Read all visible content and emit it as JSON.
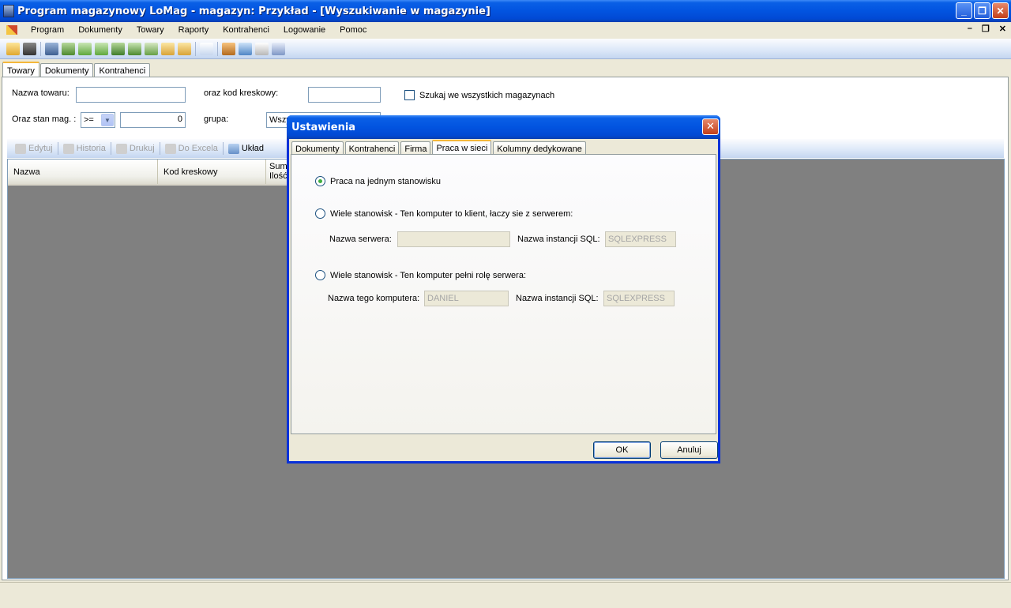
{
  "window": {
    "title": "Program magazynowy LoMag - magazyn: Przykład - [Wyszukiwanie w magazynie]"
  },
  "menu": [
    "Program",
    "Dokumenty",
    "Towary",
    "Raporty",
    "Kontrahenci",
    "Logowanie",
    "Pomoc"
  ],
  "main_tabs": [
    "Towary",
    "Dokumenty",
    "Kontrahenci"
  ],
  "filters": {
    "nazwa_label": "Nazwa towaru:",
    "kod_label": "oraz kod kreskowy:",
    "all_stores_label": "Szukaj we wszystkich magazynach",
    "stan_label": "Oraz stan mag. :",
    "stan_operator": ">=",
    "stan_value": "0",
    "grupa_label": "grupa:",
    "grupa_value": "Wszy"
  },
  "subtoolbar": {
    "edit": "Edytuj",
    "history": "Historia",
    "print": "Drukuj",
    "excel": "Do Excela",
    "layout": "Układ"
  },
  "grid": {
    "columns": [
      "Nazwa",
      "Kod kreskowy",
      "Sum",
      "Ilość"
    ]
  },
  "dialog": {
    "title": "Ustawienia",
    "tabs": [
      "Dokumenty",
      "Kontrahenci",
      "Firma",
      "Praca w sieci",
      "Kolumny dedykowane"
    ],
    "option1": "Praca na jednym stanowisku",
    "option2": "Wiele stanowisk - Ten komputer to klient, łaczy sie z serwerem:",
    "server_name_label": "Nazwa serwera:",
    "server_name_value": "",
    "sql_instance_label": "Nazwa instancji SQL:",
    "sql_instance_value": "SQLEXPRESS",
    "option3": "Wiele stanowisk - Ten komputer pełni rolę serwera:",
    "computer_name_label": "Nazwa tego komputera:",
    "computer_name_value": "DANIEL",
    "sql_instance2_label": "Nazwa instancji SQL:",
    "sql_instance2_value": "SQLEXPRESS",
    "ok": "OK",
    "cancel": "Anuluj"
  }
}
